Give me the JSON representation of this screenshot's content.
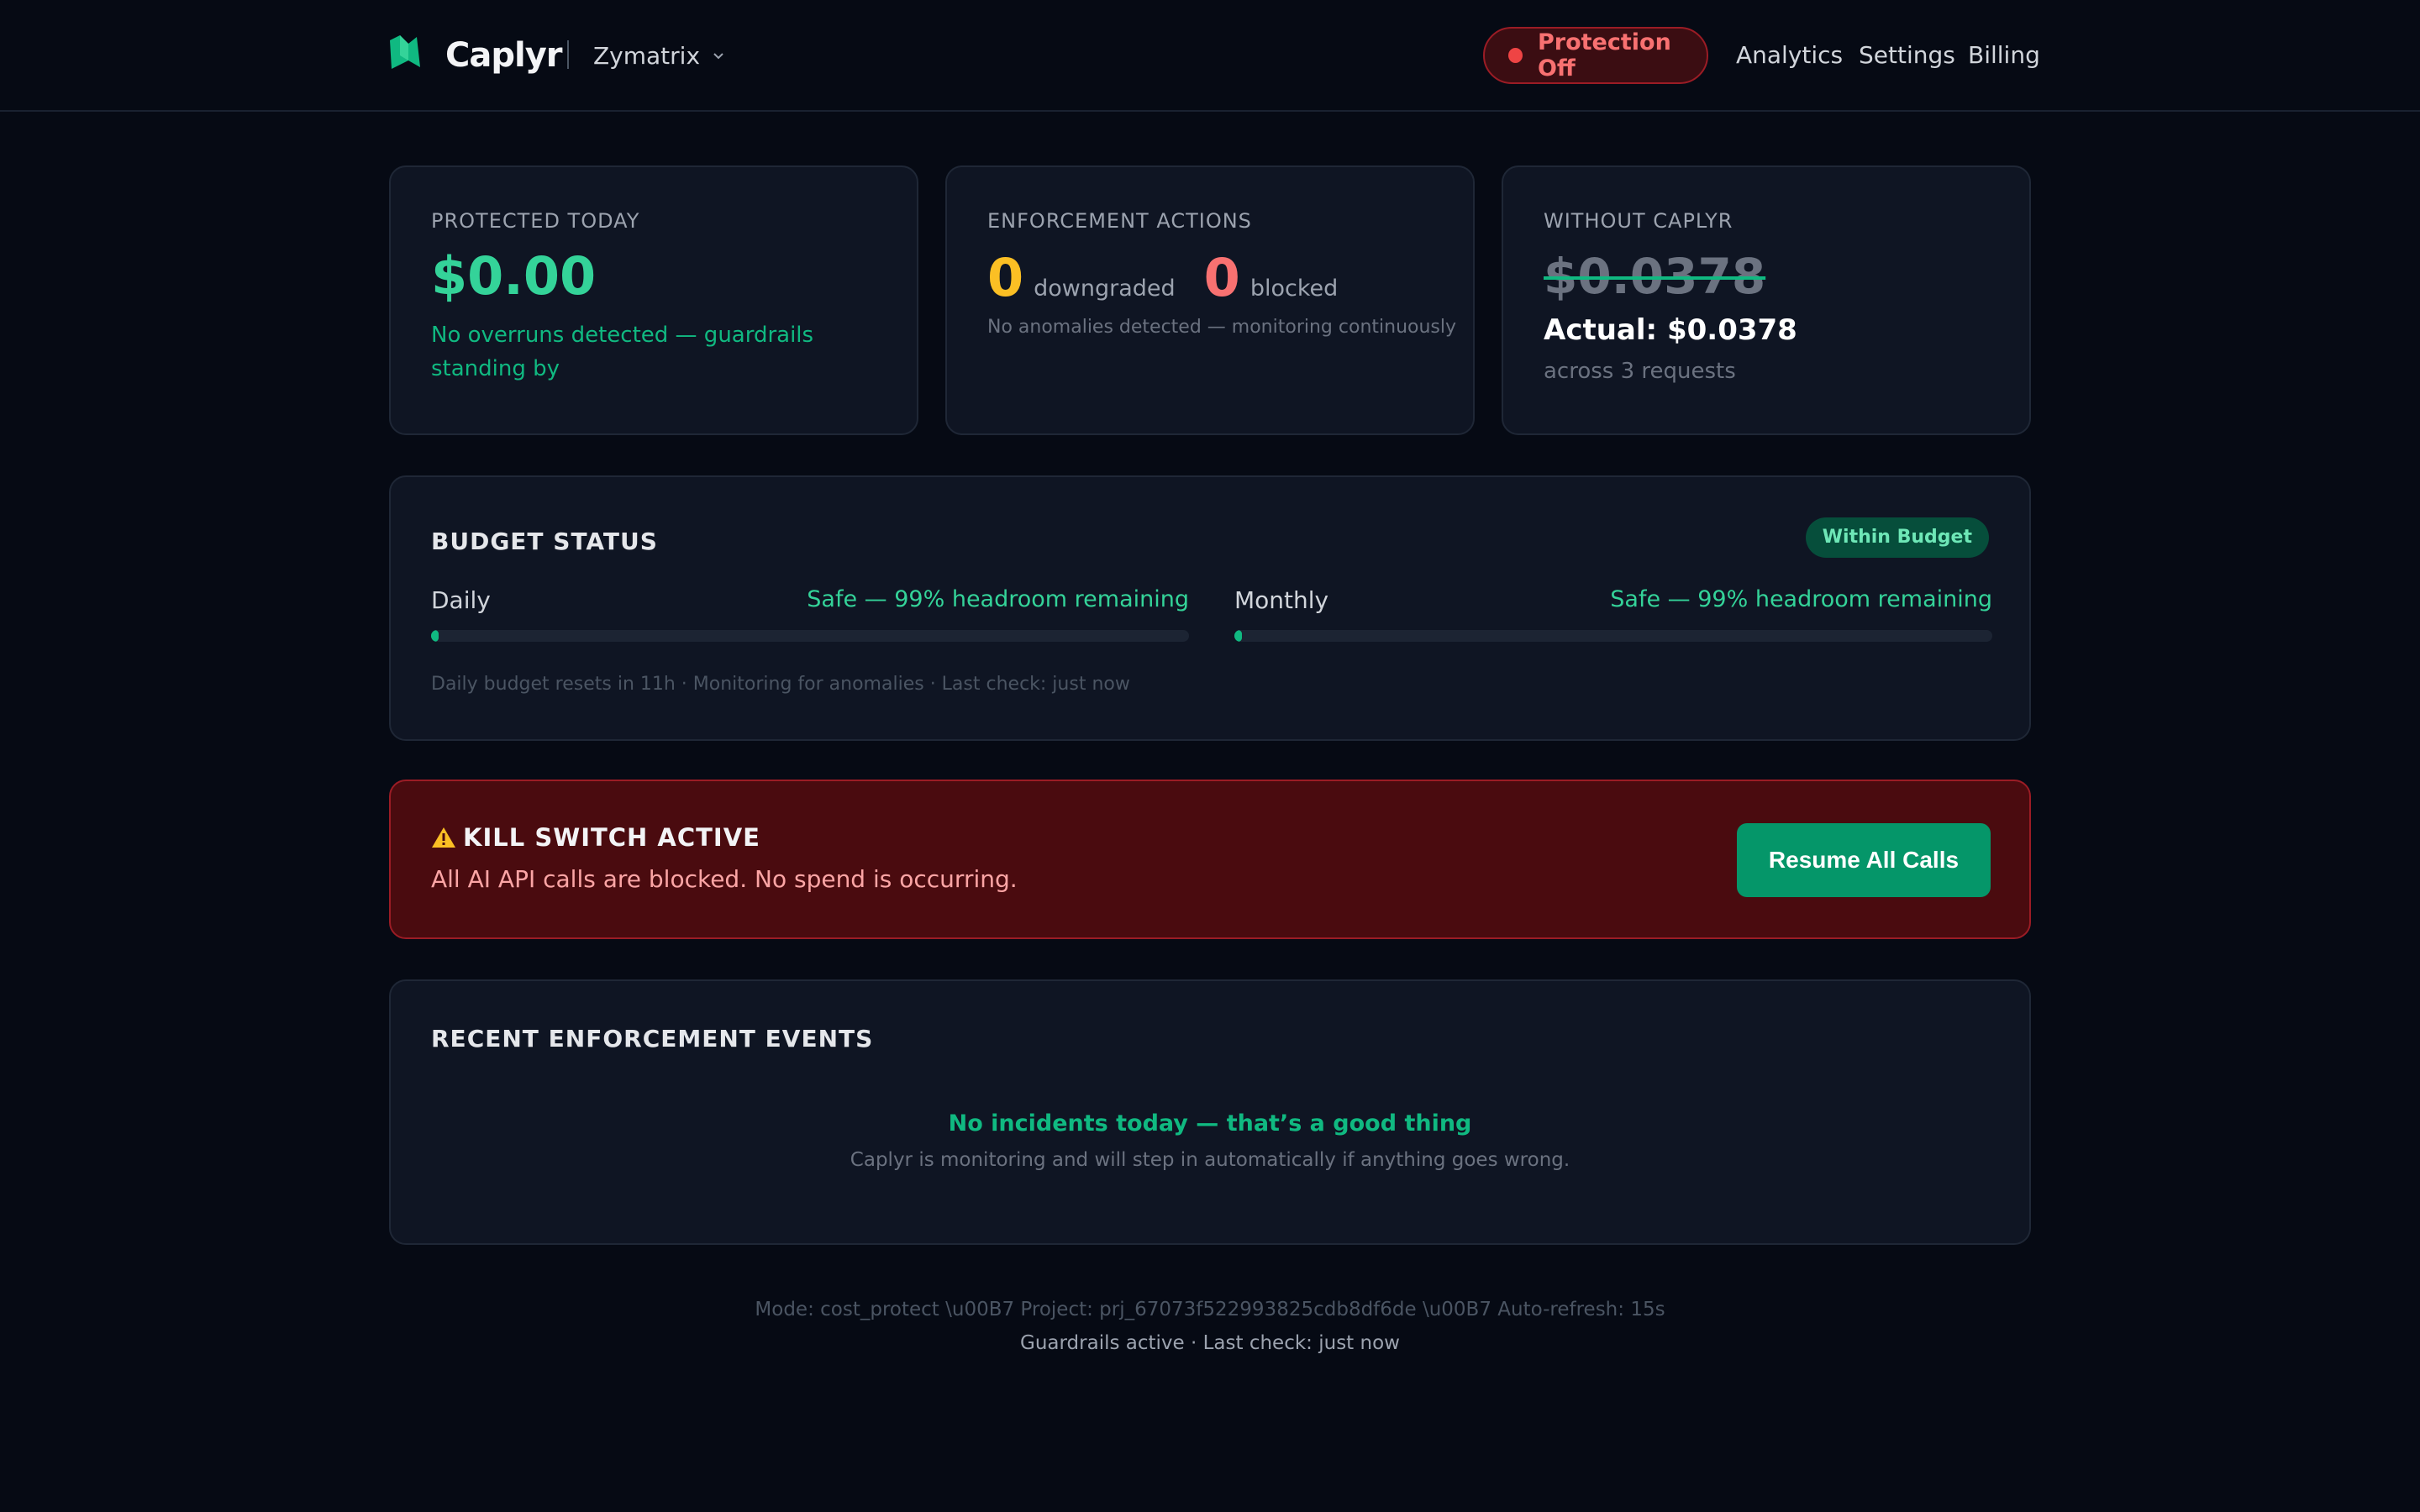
{
  "header": {
    "brand": "Caplyr",
    "logo_icon": "caplyr-logo-icon",
    "project": "Zymatrix",
    "protection_label": "Protection Off",
    "nav": [
      "Analytics",
      "Settings",
      "Billing"
    ]
  },
  "stats": {
    "protected": {
      "label": "PROTECTED TODAY",
      "amount": "$0.00",
      "note": "No overruns detected — guardrails standing by"
    },
    "enforcement": {
      "label": "ENFORCEMENT ACTIONS",
      "downgraded_count": "0",
      "downgraded_label": "downgraded",
      "blocked_count": "0",
      "blocked_label": "blocked",
      "note": "No anomalies detected — monitoring continuously"
    },
    "without": {
      "label": "WITHOUT CAPLYR",
      "amount": "$0.0378",
      "actual": "Actual: $0.0378",
      "note": "across 3 requests"
    }
  },
  "budget": {
    "title": "BUDGET STATUS",
    "badge": "Within Budget",
    "daily": {
      "name": "Daily",
      "status": "Safe — 99% headroom remaining",
      "used_percent": 1
    },
    "monthly": {
      "name": "Monthly",
      "status": "Safe — 99% headroom remaining",
      "used_percent": 1
    },
    "footer": "Daily budget resets in 11h · Monitoring for anomalies · Last check: just now"
  },
  "kill_switch": {
    "title": "KILL SWITCH ACTIVE",
    "message": "All AI API calls are blocked. No spend is occurring.",
    "button": "Resume All Calls"
  },
  "events": {
    "title": "RECENT ENFORCEMENT EVENTS",
    "empty_title": "No incidents today — that’s a good thing",
    "empty_sub": "Caplyr is monitoring and will step in automatically if anything goes wrong."
  },
  "footer": {
    "line1": "Mode: cost_protect \\u00B7 Project: prj_67073f522993825cdb8df6de \\u00B7 Auto-refresh: 15s",
    "line2": "Guardrails active · Last check: just now"
  },
  "colors": {
    "accent_green": "#10b981",
    "danger_red": "#ef4444",
    "warning_yellow": "#fbbf24",
    "blocked_red": "#f87171"
  }
}
